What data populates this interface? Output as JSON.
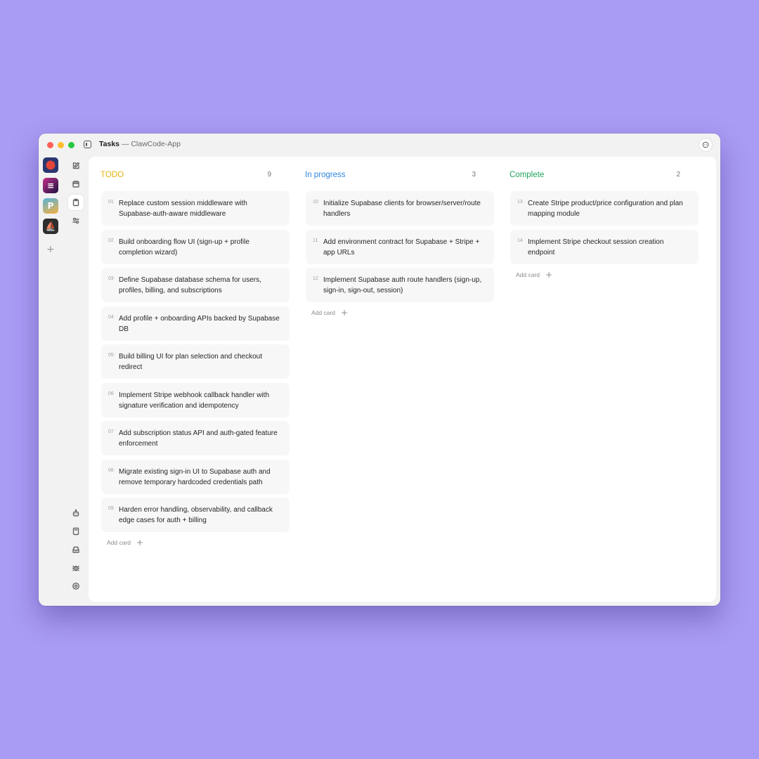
{
  "window": {
    "title_strong": "Tasks",
    "title_rest": " — ClawCode-App"
  },
  "colors": {
    "todo": "#e3b512",
    "in_progress": "#2f86dc",
    "complete": "#1fa35e"
  },
  "columns": [
    {
      "title": "TODO",
      "count": "9",
      "cards": [
        {
          "num": "01",
          "text": "Replace custom session middleware with Supabase-auth-aware middleware"
        },
        {
          "num": "02",
          "text": "Build onboarding flow UI (sign-up + profile completion wizard)"
        },
        {
          "num": "03",
          "text": "Define Supabase database schema for users, profiles, billing, and subscriptions"
        },
        {
          "num": "04",
          "text": "Add profile + onboarding APIs backed by Supabase DB"
        },
        {
          "num": "05",
          "text": "Build billing UI for plan selection and checkout redirect"
        },
        {
          "num": "06",
          "text": "Implement Stripe webhook callback handler with signature verification and idempotency"
        },
        {
          "num": "07",
          "text": "Add subscription status API and auth-gated feature enforcement"
        },
        {
          "num": "08",
          "text": "Migrate existing sign-in UI to Supabase auth and remove temporary hardcoded credentials path"
        },
        {
          "num": "09",
          "text": "Harden error handling, observability, and callback edge cases for auth + billing"
        }
      ],
      "add_label": "Add card"
    },
    {
      "title": "In progress",
      "count": "3",
      "cards": [
        {
          "num": "10",
          "text": "Initialize Supabase clients for browser/server/route handlers"
        },
        {
          "num": "11",
          "text": "Add environment contract for Supabase + Stripe + app URLs"
        },
        {
          "num": "12",
          "text": "Implement Supabase auth route handlers (sign-up, sign-in, sign-out, session)"
        }
      ],
      "add_label": "Add card"
    },
    {
      "title": "Complete",
      "count": "2",
      "cards": [
        {
          "num": "13",
          "text": "Create Stripe product/price configuration and plan mapping module"
        },
        {
          "num": "14",
          "text": "Implement Stripe checkout session creation endpoint"
        }
      ],
      "add_label": "Add card"
    }
  ],
  "icons": {
    "rail_apps": [
      "crab-app-icon",
      "document-app-icon",
      "parking-app-icon",
      "boat-app-icon"
    ],
    "rail_add": "+",
    "tools_top": [
      "compose-icon",
      "calendar-icon",
      "tasks-icon",
      "skills-icon"
    ],
    "tools_bottom": [
      "robot-icon",
      "notes-icon",
      "inbox-icon",
      "bug-icon",
      "settings-icon"
    ]
  }
}
